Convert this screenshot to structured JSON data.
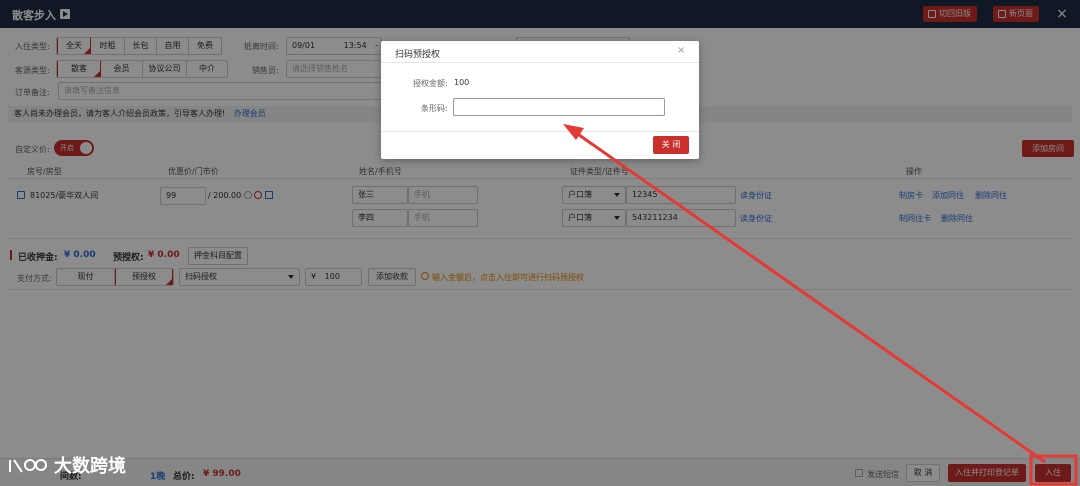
{
  "window": {
    "title": "散客步入",
    "btn_switch": "切回旧版",
    "btn_newpage": "新页面",
    "close": "×"
  },
  "form": {
    "checkin_type_label": "入住类型:",
    "checkin_types": [
      "全天",
      "时租",
      "长包",
      "自用",
      "免费"
    ],
    "arrival_label": "抵离时间:",
    "arrival_date": "09/01",
    "arrival_time": "13:54",
    "arrival_dash": "-",
    "source_label": "客源类型:",
    "source_types": [
      "散客",
      "会员",
      "协议公司",
      "中介"
    ],
    "sales_label": "销售员:",
    "sales_placeholder": "请选择销售姓名",
    "remark_label": "订单备注:",
    "remark_placeholder": "请填写备注信息"
  },
  "notice": {
    "text": "客人尚未办理会员，请为客人介绍会员政策，引导客人办理!",
    "link": "办理会员"
  },
  "custom_price": {
    "label": "自定义价:",
    "toggle": "开启"
  },
  "add_room_btn": "添加房间",
  "table": {
    "headers": [
      "房号/房型",
      "优惠价/门市价",
      "姓名/手机号",
      "证件类型/证件号",
      "操作"
    ],
    "room": "81025/豪华双人间",
    "price_value": "99",
    "price_rack": "/ 200.00",
    "guests": [
      {
        "name": "张三",
        "phone_placeholder": "手机",
        "id_type": "户口簿",
        "id_no": "12345",
        "read": "读身份证",
        "actions": [
          "制房卡",
          "添加同住",
          "删除同住"
        ]
      },
      {
        "name": "李四",
        "phone_placeholder": "手机",
        "id_type": "户口簿",
        "id_no": "543211234",
        "read": "读身份证",
        "actions": [
          "制同住卡",
          "删除同住"
        ]
      }
    ]
  },
  "payment": {
    "received_label": "已收押金:",
    "received_value": "¥ 0.00",
    "preauth_label": "预授权:",
    "preauth_value": "¥ 0.00",
    "deposit_config_btn": "押金科目配置",
    "method_label": "支付方式:",
    "methods": [
      "现付",
      "预授权"
    ],
    "method_select": "扫码授权",
    "amount_prefix": "¥",
    "amount": "100",
    "add_btn": "添加收款",
    "hint": "输入金额后，点击入住即可进行扫码预授权"
  },
  "bottom": {
    "nights_label": "间数:",
    "nights_value": "1晚",
    "total_label": "总价:",
    "total_value": "¥ 99.00",
    "sms_label": "发送短信",
    "cancel_btn": "取 消",
    "print_btn": "入住并打印登记单",
    "checkin_btn": "入住"
  },
  "modal": {
    "title": "扫码预授权",
    "close": "×",
    "amount_label": "授权金额:",
    "amount_value": "100",
    "barcode_label": "条形码:",
    "barcode_value": "",
    "close_btn": "关 闭"
  },
  "watermark": "大数跨境",
  "colors": {
    "accent_red": "#c9302c",
    "link_blue": "#2b6fd6",
    "titlebar": "#1f2d44",
    "annotation_red": "#e53935"
  }
}
